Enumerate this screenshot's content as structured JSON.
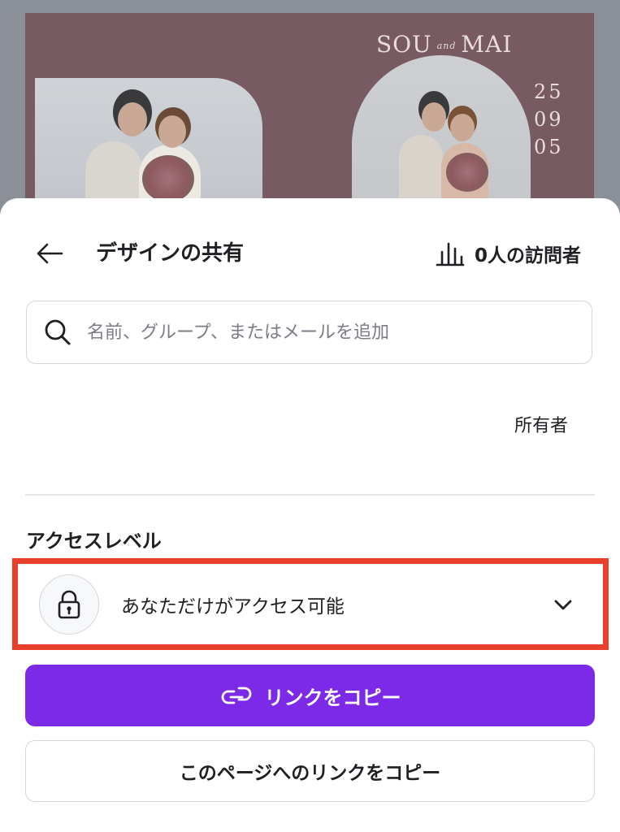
{
  "preview": {
    "names": {
      "left": "SOU",
      "and": "and",
      "right": "MAI"
    },
    "date": [
      "25",
      "09",
      "05"
    ]
  },
  "header": {
    "title": "デザインの共有",
    "visitors": "0人の訪問者",
    "back_icon": "arrow-left-icon",
    "visitors_icon": "bar-chart-icon"
  },
  "search": {
    "placeholder": "名前、グループ、またはメールを追加",
    "value": "",
    "icon": "search-icon"
  },
  "owner": {
    "role_label": "所有者"
  },
  "access": {
    "heading": "アクセスレベル",
    "selected": "あなただけがアクセス可能",
    "icon": "lock-icon",
    "dropdown_icon": "chevron-down-icon",
    "highlight_color": "#e8402b"
  },
  "buttons": {
    "copy_link": "リンクをコピー",
    "copy_link_icon": "link-icon",
    "copy_page_link": "このページへのリンクをコピー"
  },
  "colors": {
    "accent": "#7d2ae8",
    "text": "#1f1f24",
    "border": "#d3d6dc"
  }
}
